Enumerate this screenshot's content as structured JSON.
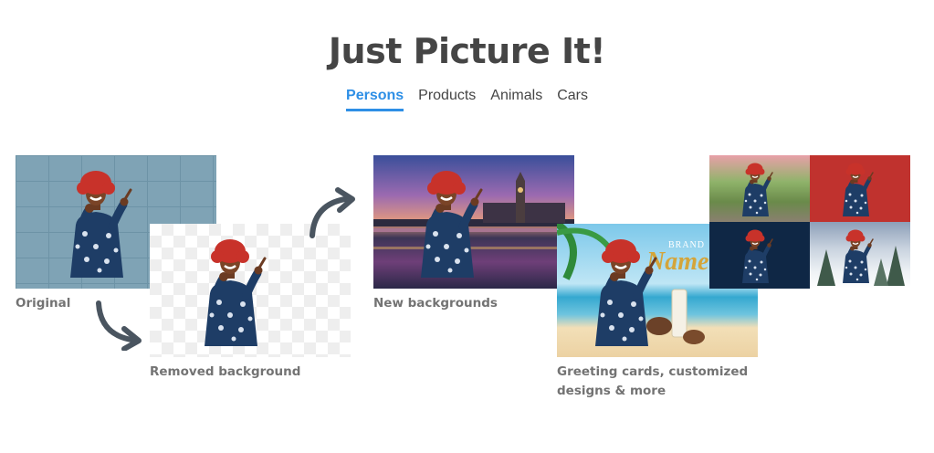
{
  "header": {
    "title": "Just Picture It!"
  },
  "tabs": [
    {
      "label": "Persons",
      "active": true
    },
    {
      "label": "Products",
      "active": false
    },
    {
      "label": "Animals",
      "active": false
    },
    {
      "label": "Cars",
      "active": false
    }
  ],
  "captions": {
    "original": "Original",
    "removed": "Removed background",
    "new_backgrounds": "New backgrounds",
    "greeting_line1": "Greeting cards, customized",
    "greeting_line2": "designs & more"
  },
  "card_text": {
    "brand": "BRAND",
    "name": "Name"
  },
  "colors": {
    "accent": "#2e8fe6",
    "caption": "#737373",
    "title": "#454545",
    "arrow": "#4a5560"
  },
  "icons": [
    "curved-arrow-down-icon",
    "curved-arrow-up-icon"
  ]
}
